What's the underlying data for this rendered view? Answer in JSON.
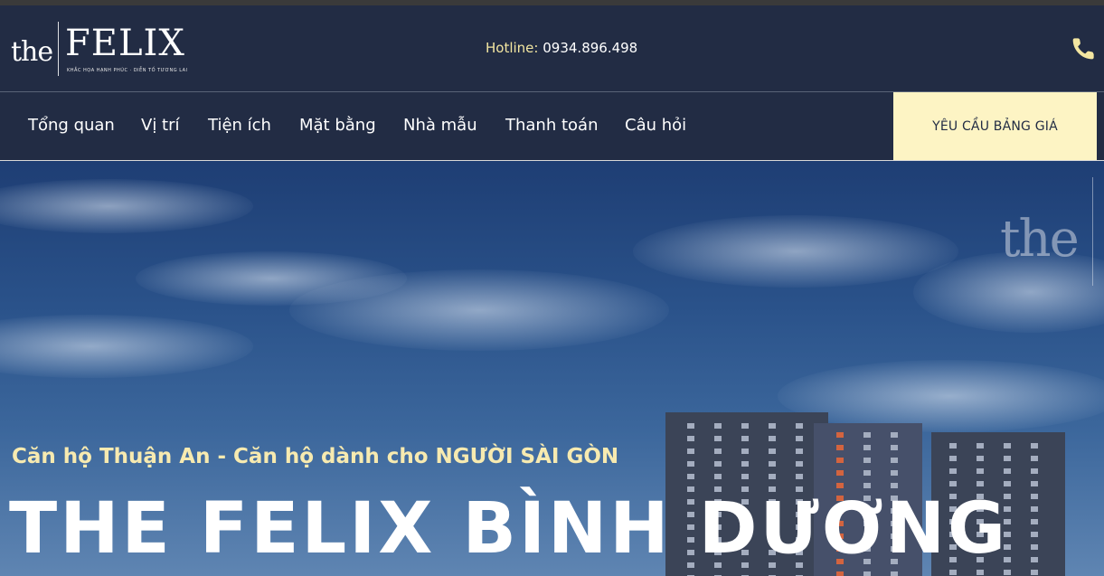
{
  "brand": {
    "logo_prefix": "the",
    "logo_name": "FELIX",
    "tagline": "KHẮC HỌA HẠNH PHÚC · DIỄN TỐ TƯƠNG LAI"
  },
  "header": {
    "hotline_label": "Hotline:",
    "hotline_number": "0934.896.498",
    "phone_icon": "phone-icon"
  },
  "nav": {
    "items": [
      {
        "label": "Tổng quan"
      },
      {
        "label": "Vị trí"
      },
      {
        "label": "Tiện ích"
      },
      {
        "label": "Mặt bằng"
      },
      {
        "label": "Nhà mẫu"
      },
      {
        "label": "Thanh toán"
      },
      {
        "label": "Câu hỏi"
      }
    ],
    "cta_label": "YÊU CẦU BẢNG GIÁ"
  },
  "hero": {
    "watermark": "the",
    "subtitle": "Căn hộ Thuận An - Căn hộ dành cho NGƯỜI SÀI GÒN",
    "title": "THE FELIX BÌNH DƯƠNG"
  },
  "colors": {
    "header_bg": "#222c44",
    "accent_yellow": "#f3e6a1",
    "cta_bg": "#fdf4c4"
  }
}
